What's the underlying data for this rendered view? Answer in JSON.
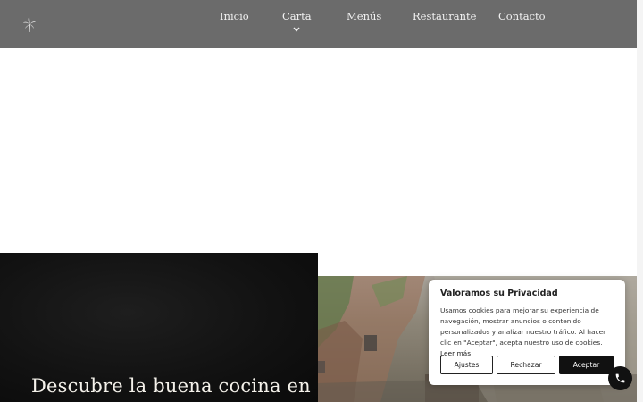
{
  "nav": {
    "items": [
      {
        "label": "Inicio"
      },
      {
        "label": "Carta"
      },
      {
        "label": "Menús"
      },
      {
        "label": "Restaurante"
      },
      {
        "label": "Contacto"
      }
    ]
  },
  "hero": {
    "title": "Descubre la buena cocina en"
  },
  "cookie": {
    "title": "Valoramos su Privacidad",
    "text": "Usamos cookies para mejorar su experiencia de navegación, mostrar anuncios o contenido personalizados y analizar nuestro tráfico. Al hacer clic en \"Aceptar\", acepta nuestro uso de cookies.",
    "link": "Leer más",
    "settings": "Ajustes",
    "reject": "Rechazar",
    "accept": "Aceptar"
  },
  "colors": {
    "header": "#6b6b6b",
    "accent": "#111111"
  },
  "icons": {
    "logo": "palm-logo-icon",
    "chevron": "chevron-down-icon",
    "call": "phone-icon"
  }
}
